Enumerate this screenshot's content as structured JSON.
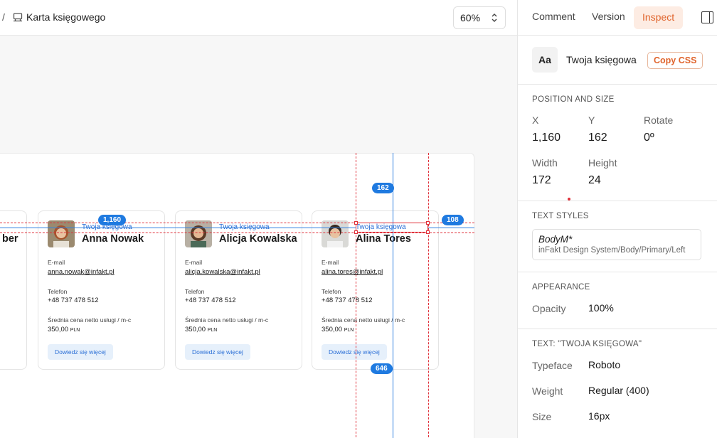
{
  "breadcrumb": {
    "separator": "/",
    "icon": "component-icon",
    "title": "Karta księgowego"
  },
  "zoom": {
    "value": "60%"
  },
  "canvas": {
    "partial_card_name_fragment": "ber",
    "cards": [
      {
        "role": "Twoja księgowa",
        "name": "Anna Nowak",
        "email_label": "E-mail",
        "email": "anna.nowak@infakt.pl",
        "phone_label": "Telefon",
        "phone": "+48 737 478 512",
        "price_label": "Średnia cena netto usługi / m-c",
        "price": "350,00",
        "currency": "PLN",
        "button": "Dowiedz się więcej"
      },
      {
        "role": "Twoja księgowa",
        "name": "Alicja Kowalska",
        "email_label": "E-mail",
        "email": "alicja.kowalska@infakt.pl",
        "phone_label": "Telefon",
        "phone": "+48 737 478 512",
        "price_label": "Średnia cena netto usługi / m-c",
        "price": "350,00",
        "currency": "PLN",
        "button": "Dowiedz się więcej"
      },
      {
        "role": "Twoja księgowa",
        "name": "Alina Tores",
        "email_label": "E-mail",
        "email": "alina.tores@infakt.pl",
        "phone_label": "Telefon",
        "phone": "+48 737 478 512",
        "price_label": "Średnia cena netto usługi / m-c",
        "price": "350,00",
        "currency": "PLN",
        "button": "Dowiedz się więcej"
      }
    ],
    "measurements": {
      "top": "162",
      "left": "1,160",
      "right": "108",
      "bottom": "646"
    }
  },
  "panel": {
    "tabs": [
      "Comment",
      "Version",
      "Inspect"
    ],
    "active_tab": "Inspect",
    "layer": {
      "icon_text": "Aa",
      "name": "Twoja księgowa",
      "copy_button": "Copy CSS"
    },
    "position_size": {
      "title": "POSITION AND SIZE",
      "x_label": "X",
      "x": "1,160",
      "y_label": "Y",
      "y": "162",
      "rotate_label": "Rotate",
      "rotate": "0º",
      "width_label": "Width",
      "width": "172",
      "height_label": "Height",
      "height": "24"
    },
    "text_styles": {
      "title": "TEXT STYLES",
      "style_name": "BodyM*",
      "style_path": "inFakt Design System/Body/Primary/Left"
    },
    "appearance": {
      "title": "APPEARANCE",
      "opacity_label": "Opacity",
      "opacity": "100%"
    },
    "text_section": {
      "title": "TEXT: \"TWOJA KSIĘGOWA\"",
      "typeface_label": "Typeface",
      "typeface": "Roboto",
      "weight_label": "Weight",
      "weight": "Regular (400)",
      "size_label": "Size",
      "size": "16px"
    }
  },
  "colors": {
    "accent": "#e0642c",
    "link_blue": "#2b6fd6",
    "measure_blue": "#1f7ae0",
    "guide_red": "#e0303a"
  }
}
